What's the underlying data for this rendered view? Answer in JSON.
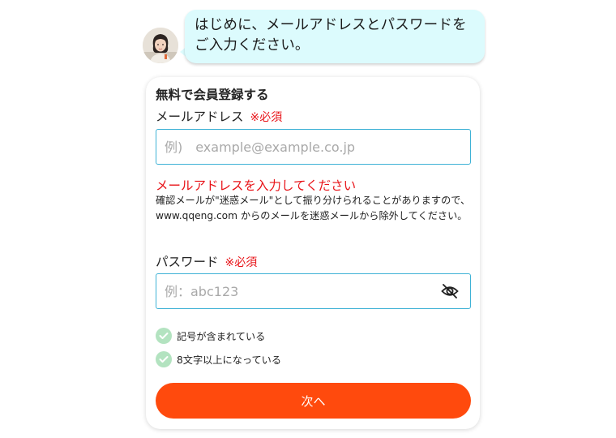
{
  "chat": {
    "message": "はじめに、メールアドレスとパスワードをご入力ください。"
  },
  "form": {
    "title": "無料で会員登録する",
    "email": {
      "label": "メールアドレス",
      "required": "※必須",
      "placeholder": "例)　example@example.co.jp",
      "value": ""
    },
    "email_error": "メールアドレスを入力してください",
    "email_note": "確認メールが\"迷惑メール\"として振り分けられることがありますので、www.qqeng.com からのメールを迷惑メールから除外してください。",
    "password": {
      "label": "パスワード",
      "required": "※必須",
      "placeholder": "例：abc123",
      "value": "",
      "toggle_icon": "eye-off-icon"
    },
    "requirements": [
      {
        "text": "記号が含まれている",
        "icon": "check-circle-icon"
      },
      {
        "text": "8文字以上になっている",
        "icon": "check-circle-icon"
      }
    ],
    "next_button": "次へ"
  },
  "colors": {
    "accent": "#ff4a0d",
    "error": "#e8151a",
    "input_border": "#3fb2d6",
    "bubble_bg": "#dcfbfd",
    "check_bg": "#b3e3c0"
  }
}
